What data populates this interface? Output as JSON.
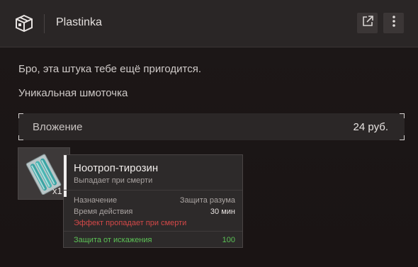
{
  "header": {
    "title": "Plastinka",
    "app_icon": "box-icon",
    "external_icon": "external-link-icon",
    "more_icon": "more-vertical-icon"
  },
  "content": {
    "line1": "Бро, эта штука тебе ещё пригодится.",
    "line2": "Уникальная шмоточка",
    "investment": {
      "label": "Вложение",
      "value": "24 руб."
    }
  },
  "item": {
    "icon": "nootropic-item-icon",
    "count": "x1",
    "tooltip": {
      "name": "Ноотроп-тирозин",
      "subtitle": "Выпадает при смерти",
      "rows": [
        {
          "label": "Назначение",
          "value": "Защита разума"
        },
        {
          "label": "Время действия",
          "value": "30 мин"
        }
      ],
      "warning": "Эффект пропадает при смерти",
      "protection": {
        "label": "Защита от искажения",
        "value": "100"
      }
    }
  },
  "colors": {
    "background": "#1b1616",
    "header": "#2a2626",
    "warning": "#d34848",
    "positive": "#5cc156"
  }
}
